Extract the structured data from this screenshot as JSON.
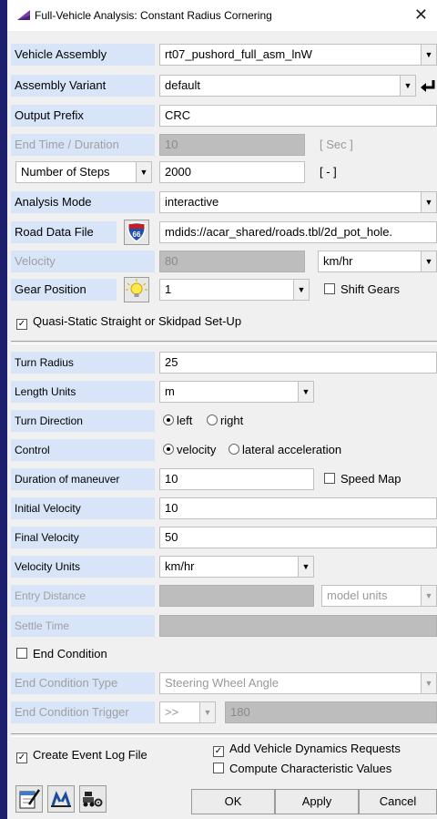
{
  "window": {
    "title": "Full-Vehicle Analysis: Constant Radius Cornering",
    "close": "✕"
  },
  "form": {
    "vehicle_assembly": {
      "label": "Vehicle Assembly",
      "value": "rt07_pushord_full_asm_lnW"
    },
    "assembly_variant": {
      "label": "Assembly Variant",
      "value": "default"
    },
    "output_prefix": {
      "label": "Output Prefix",
      "value": "CRC"
    },
    "end_time": {
      "label": "End Time / Duration",
      "value": "10",
      "unit": "[ Sec ]"
    },
    "steps": {
      "label": "Number of Steps",
      "value": "2000",
      "unit": "[ - ]"
    },
    "analysis_mode": {
      "label": "Analysis Mode",
      "value": "interactive"
    },
    "road_data_file": {
      "label": "Road Data File",
      "value": "mdids://acar_shared/roads.tbl/2d_pot_hole."
    },
    "velocity": {
      "label": "Velocity",
      "value": "80",
      "unit": "km/hr"
    },
    "gear_position": {
      "label": "Gear Position",
      "value": "1",
      "shift_gears": "Shift Gears"
    },
    "quasi_static": {
      "label": "Quasi-Static Straight or Skidpad Set-Up",
      "checked": true
    }
  },
  "maneuver": {
    "turn_radius": {
      "label": "Turn Radius",
      "value": "25"
    },
    "length_units": {
      "label": "Length Units",
      "value": "m"
    },
    "turn_direction": {
      "label": "Turn Direction",
      "options": [
        "left",
        "right"
      ],
      "selected": "left"
    },
    "control": {
      "label": "Control",
      "options": [
        "velocity",
        "lateral acceleration"
      ],
      "selected": "velocity"
    },
    "duration": {
      "label": "Duration of maneuver",
      "value": "10",
      "speed_map": "Speed Map"
    },
    "initial_velocity": {
      "label": "Initial Velocity",
      "value": "10"
    },
    "final_velocity": {
      "label": "Final Velocity",
      "value": "50"
    },
    "velocity_units": {
      "label": "Velocity Units",
      "value": "km/hr"
    },
    "entry_distance": {
      "label": "Entry Distance",
      "value": "",
      "unit": "model units"
    },
    "settle_time": {
      "label": "Settle Time",
      "value": ""
    },
    "end_condition": {
      "label": "End Condition",
      "checked": false
    },
    "end_condition_type": {
      "label": "End Condition Type",
      "value": "Steering Wheel Angle"
    },
    "end_condition_trigger": {
      "label": "End Condition Trigger",
      "op": ">>",
      "value": "180"
    }
  },
  "footer": {
    "create_event_log": {
      "label": "Create Event Log File",
      "checked": true
    },
    "add_vdr": {
      "label": "Add Vehicle Dynamics Requests",
      "checked": true
    },
    "compute_char": {
      "label": "Compute Characteristic Values",
      "checked": false
    },
    "ok": "OK",
    "apply": "Apply",
    "cancel": "Cancel",
    "icons": [
      "notepad-pen-icon",
      "swing-graph-icon",
      "vehicle-settings-icon"
    ]
  },
  "colors": {
    "label_bg": "#d8e4f8",
    "disabled_field": "#bdbdbd",
    "accent": "#1e1e6e"
  }
}
